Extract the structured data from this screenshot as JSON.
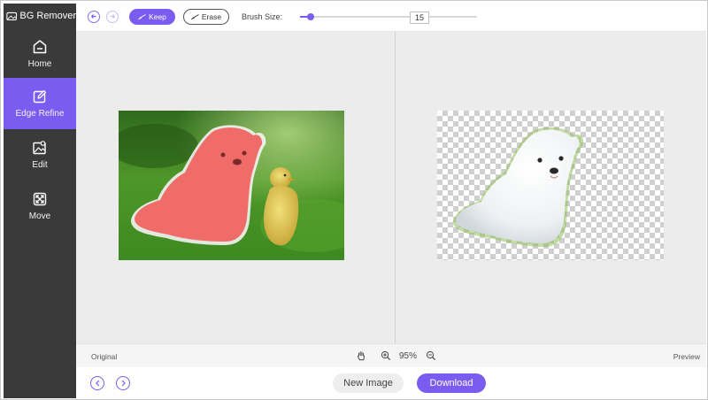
{
  "app": {
    "title": "BG Remover",
    "logo_icon": "cloud-image-icon"
  },
  "sidebar": {
    "items": [
      {
        "label": "Home",
        "icon": "home-icon",
        "active": false
      },
      {
        "label": "Edge Refine",
        "icon": "edge-refine-icon",
        "active": true
      },
      {
        "label": "Edit",
        "icon": "image-edit-icon",
        "active": false
      },
      {
        "label": "Move",
        "icon": "move-arrows-icon",
        "active": false
      }
    ]
  },
  "toolbar": {
    "undo_icon": "undo-icon",
    "redo_icon": "redo-icon",
    "keep_label": "Keep",
    "erase_label": "Erase",
    "brush_size_label": "Brush Size:",
    "brush_size_value": "15",
    "brush_slider_fraction": 0.06
  },
  "status": {
    "original_label": "Original",
    "preview_label": "Preview",
    "zoom": "95%"
  },
  "bottom": {
    "new_image_label": "New Image",
    "download_label": "Download"
  },
  "colors": {
    "accent": "#7b5cf0",
    "sidebar_bg": "#3a3a3a",
    "canvas_bg": "#ececec",
    "keep_overlay": "#f0625f"
  }
}
